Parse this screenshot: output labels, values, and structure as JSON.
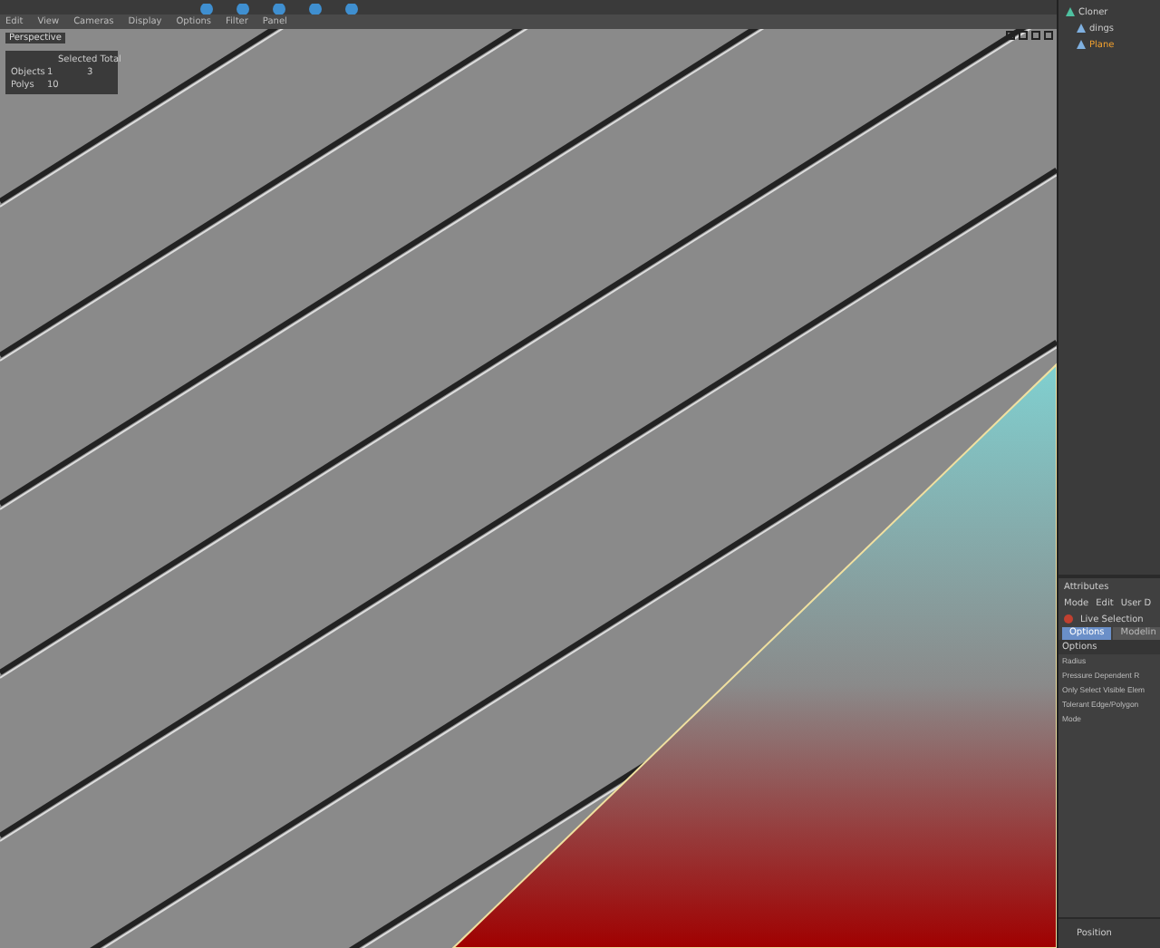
{
  "menu": [
    {
      "label": "Edit"
    },
    {
      "label": "View"
    },
    {
      "label": "Cameras"
    },
    {
      "label": "Display"
    },
    {
      "label": "Options"
    },
    {
      "label": "Filter"
    },
    {
      "label": "Panel"
    }
  ],
  "viewport": {
    "camera_label": "Perspective",
    "stats": {
      "header": "Selected Total",
      "rows": [
        {
          "label": "Objects",
          "selected": "1",
          "total": "3"
        },
        {
          "label": "Polys",
          "selected": "10"
        }
      ]
    }
  },
  "objects": [
    {
      "name": "Cloner",
      "selected": false,
      "children": [
        {
          "name": "dings",
          "selected": false
        },
        {
          "name": "Plane",
          "selected": true
        }
      ]
    }
  ],
  "attributes": {
    "title": "Attributes",
    "menu": [
      "Mode",
      "Edit",
      "User D"
    ],
    "tool": "Live Selection",
    "tabs": [
      {
        "label": "Options",
        "selected": true
      },
      {
        "label": "Modelin",
        "selected": false
      }
    ],
    "section": "Options",
    "fields": [
      "Radius",
      "Pressure Dependent R",
      "Only Select Visible Elem",
      "Tolerant Edge/Polygon",
      "Mode"
    ]
  },
  "bottom": {
    "label": "Position"
  }
}
